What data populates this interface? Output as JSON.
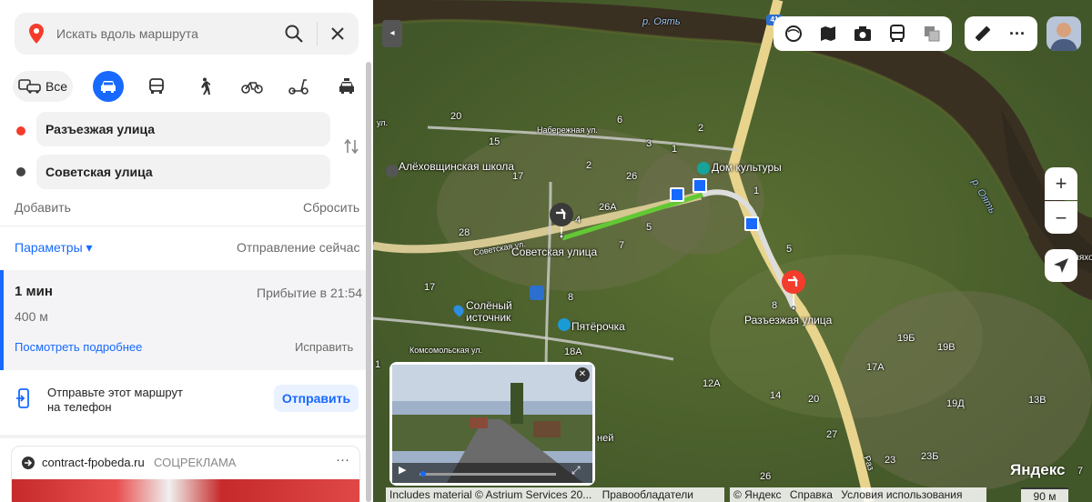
{
  "search": {
    "placeholder": "Искать вдоль маршрута"
  },
  "modes": {
    "all": "Все",
    "selected": "car",
    "items": [
      "car",
      "bus",
      "walk",
      "bike",
      "scooter",
      "taxi"
    ]
  },
  "route": {
    "from": "Разъезжая улица",
    "to": "Советская улица",
    "add": "Добавить",
    "reset": "Сбросить"
  },
  "params": {
    "label": "Параметры ▾",
    "departure": "Отправление сейчас"
  },
  "result": {
    "duration": "1 мин",
    "arrival": "Прибытие в 21:54",
    "distance": "400 м",
    "details": "Посмотреть подробнее",
    "fix": "Исправить"
  },
  "send": {
    "text_line1": "Отправьте этот маршрут",
    "text_line2": "на телефон",
    "button": "Отправить"
  },
  "ad": {
    "domain": "contract-fpobeda.ru",
    "tag": "СОЦРЕКЛАМА",
    "more": "···"
  },
  "map": {
    "rivers": [
      "р. Оять",
      "р. Оять"
    ],
    "streets": [
      "Набережная ул.",
      "Советская ул.",
      "Комсомольская ул.",
      "ул.",
      "Раз",
      "ляхо"
    ],
    "places": [
      "Алёховщинская школа",
      "Дом культуры",
      "Солёный источник",
      "Пятёрочка"
    ],
    "route_from": "Советская улица",
    "route_to": "Разъезжая улица",
    "house_numbers": [
      "20",
      "6",
      "15",
      "3",
      "1",
      "2",
      "17",
      "2",
      "26",
      "26А",
      "1",
      "28",
      "4",
      "5",
      "7",
      "5",
      "17",
      "8",
      "8",
      "18А",
      "1",
      "19Б",
      "19В",
      "17А",
      "12А",
      "14",
      "20",
      "19Д",
      "13В",
      "27",
      "23",
      "23Б",
      "26",
      "7"
    ],
    "shield": "41",
    "streetview_label": "ней",
    "zoom_in": "+",
    "zoom_out": "−",
    "logo": "Яндекс",
    "attribution": "Includes material © Astrium Services 20...",
    "rights": "Правообладатели",
    "copyright": "© Яндекс",
    "help": "Справка",
    "terms": "Условия использования",
    "scale": "90 м"
  },
  "colors": {
    "accent": "#1769ff",
    "route": "#5fcf3c",
    "pin": "#f43c2c"
  }
}
